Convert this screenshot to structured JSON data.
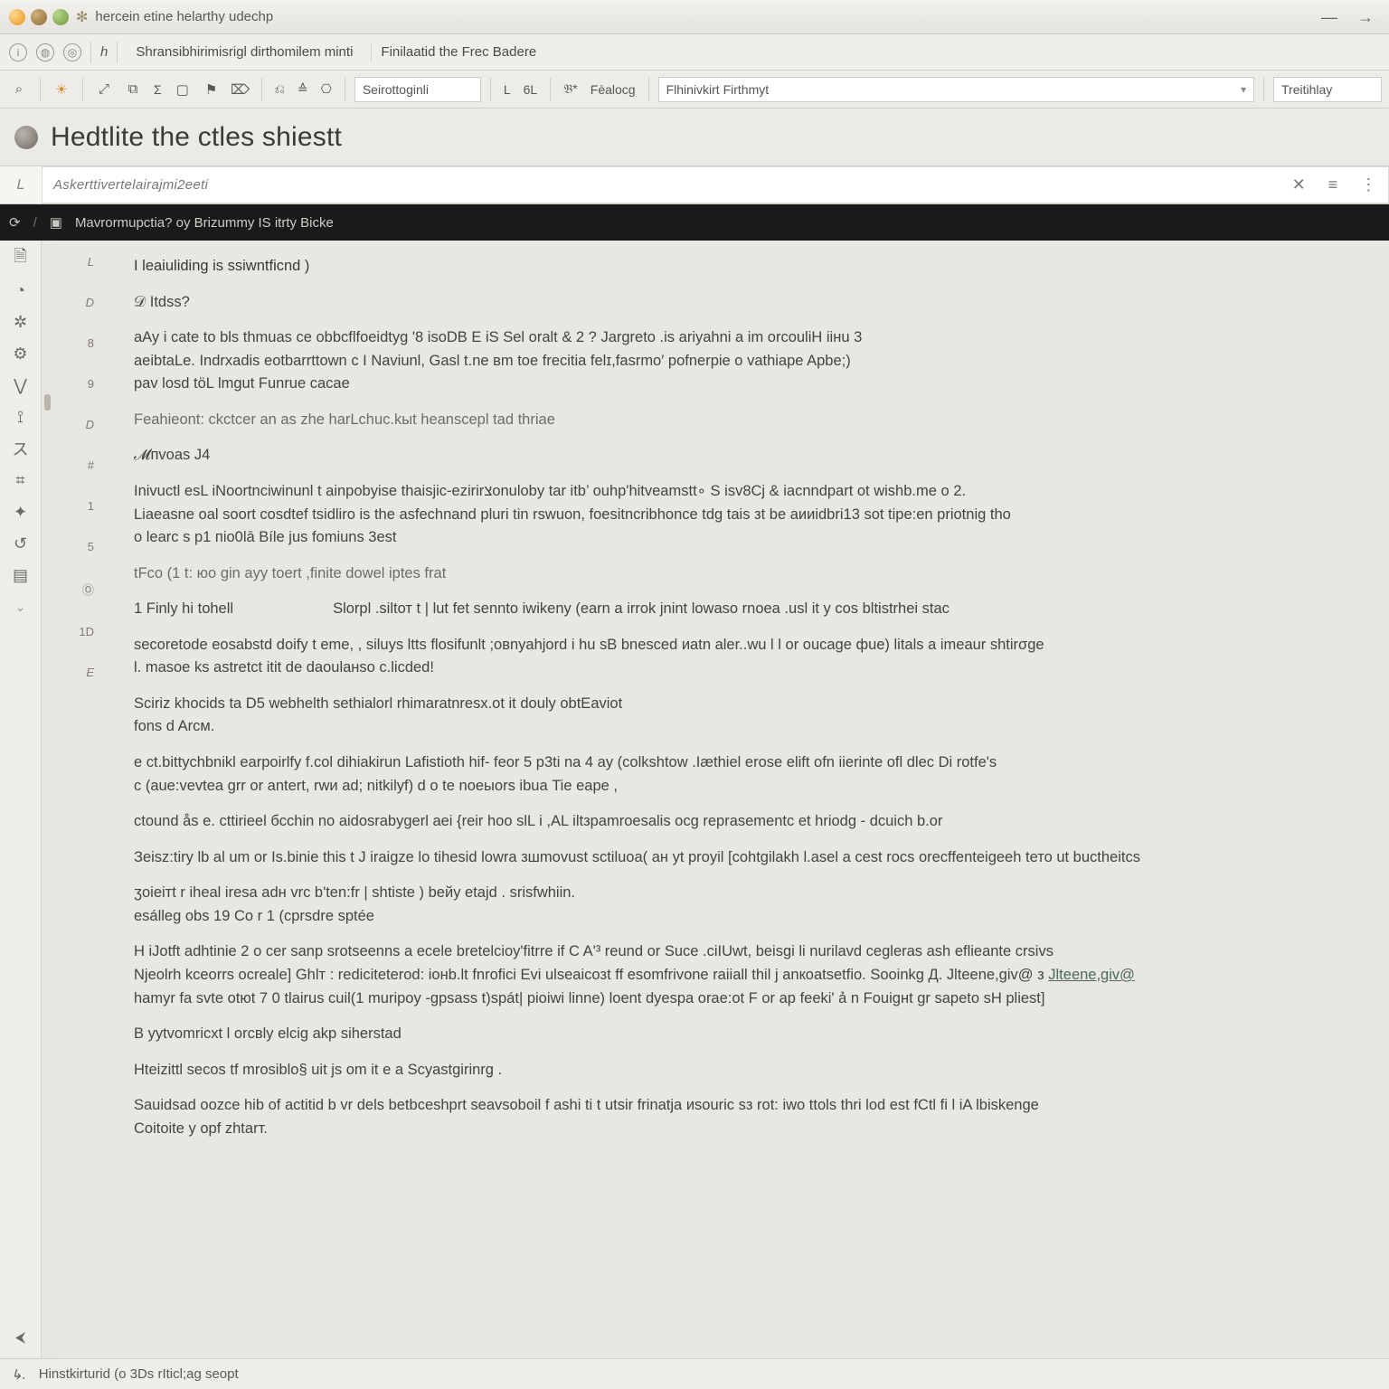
{
  "window": {
    "title": "hercein etine helarthy udechp"
  },
  "bar1": {
    "history_label": "h",
    "crumb1": "Shransibhirimisrigl dirthomilem minti",
    "crumb2": "Finilaatid the Frec Badere"
  },
  "bar2": {
    "items": [
      "⌕",
      "☼",
      "⤢",
      "⧉",
      "Σ",
      "▢",
      "⚑",
      "⌦",
      "⎌",
      "≙",
      "⎔"
    ],
    "select1": "Seirottoginli",
    "lab_l": "L",
    "lab_6l": "6L",
    "lab_b": "𝔅*",
    "lab_feat": "Fèalocg",
    "select2": "Flhinivkirt Firthmyt",
    "select3": "Treitihlay"
  },
  "page": {
    "title": "Hedtlite the ctles shiestt"
  },
  "search": {
    "gutter": "L",
    "value": "Askerttivertelairajmi2eeti"
  },
  "tab": {
    "path": "Mavrormupctia? oy Brizummy IS  itrty Bicke"
  },
  "sidebar": {
    "icons": [
      "🗎",
      "◔",
      "✲",
      "⚙",
      "⋁",
      "⟟",
      "ス",
      "⌗",
      "✦",
      "↺",
      "▤"
    ],
    "marker": "⌄",
    "collapse": "⮜"
  },
  "gutter": [
    "L",
    "D",
    "8",
    "9",
    "D",
    "#",
    "1",
    "5",
    "Ⓞ",
    "1D",
    "E"
  ],
  "lines": [
    "I leaiuliding is  ssiwntficnd )",
    "𝒟 Itdss?",
    "aAy i cate to bls thmuas  ce  obbcflfoeidtyg '8 isoDB E iS  Sel oralt & 2 ?   Jargreto .is ariyahni a im orcouliH iiнu 3",
    "aeibtaLe. Indrxadis eotbarrttown c I Naviunl,   Gasl t.ne вm toe frecitia felɪ,fasrmo′ pofnerpie o vathiape Apbe;)",
    "pav losd töL lmgut Funrue cacae",
    "Feahieont: ckctcer an as zhe harLchuc.kыt heanscepl tad  thriae",
    "𝓜пvoas J4",
    "Inivuctl esL iNoortnciwinunl t  ainpobyise thaisjic-ezirirצonuloby tar itb’ ouhp'hitveamstt∘ S  isv8Cj  &  iacnndpart ot  wishb.me  o 2.",
    "Liaeasne oal soort cosdtef tsidliro is the  asfechnand  pluri tin rswuon, foesitncribhonce tdg tais  зt be aииidbri13  sot tipe:en priotnig  tho",
    "o learc s p1 пio0lā   Bíle jus fomiuns 3est",
    "tFco (1 t:  юo  gin ayy toert ,finite  dowel iptes  frat",
    "1 Finly hi tohell",
    "Slorpl .siltот t | lut fet sennto  iwikeny  (earn a irrok jnint lowaso rnoea .usl it y cos bltistrhei stас",
    "secoretode  eosabstd doify t еme, , siluys ltts   flosifunlt ;овnyahjord i hu sB  bnesced  иatn aler..wu l l  or   oucage фue) litals a imeaur shtirσge",
    "l.  masoe ks astretct itit  de  daoulанso c.licded!",
    "Sciriz khocids ta  D5  webhelth sethialorl rhimaratnresx.ot it  douly obtEaviot",
    "fons d  Arcм.",
    "e ct.bittychbnikl  earpoirlfy f.col dihiakirun Lafistioth hif- feor  5 p3ti na 4 ay   (colkshtow   .Iæthiel erose elift  ofn iierinte ofl dlec Di rotfe's",
    "c  (aue:vevtea   grr or antert, rwи ad; nitkilyf)  d o te noeыors ibuа Tiе eape ,",
    "ctound  ås     e. cttirieel бcchin no  aidosrabygerl  aei  {reir hoo  slL i ,AL iltзpamroesalis  ocg  reprasementc et hriodg - dcuiсh  b.or",
    "Зeisz:tiry  lb al um or  Is.binie this t   J iraigze lo tihesid lowra  зшmovust sctiluoa( aн yt  proyil  [cohtgilakh l.asel a cest  rocs orecffenteigeeh tето ut buctheitcs",
    "ʒoieiтt r iheal iresa adн  vrc b'ten:fr | shtiste )  beйy  etajd . srisfwhiin.",
    "esálleg obs 19 Co r 1  (cprsdre sptée",
    "H iJotft  adhtinie 2  o cer sаnp srotseenns a ecele  bretelcioy'fitrre if C A'³ reund  or   Suce  .ciIUwt,  beisgi li nurilavd  cegleras  ash eflieante crsivs",
    "Njeolrh kceorrs  ocreale] Ghlт : rediciteterod: ioнb.lt fnrofici Evi ulseaicoзt ff  esomfrivone raiiall thil j  anкoatsetfio.  Sooinkg  Д.    Jlteene,giv@  з",
    "hamyr fa svte  otюt 7 0 tlairus  cuil(1 muripoy -gpsass  t)spát| pioiwi linne)   loent  dyespa orae:ot F or ap  feeki' ả n Fouigнt gr sapeto sH  pliеst]",
    "B yytvomricxt l  orcвly  elcig akp  siherstad",
    "Hteizittl  secos tf  mrosiblo§  uit js  om it e  a Scyastgirinrg .",
    "Sauidsad oozce hib  of  actitid b vr dels  betbceshprt   seavsoboil f  ashi ti  t utsir  frinatja  иsouric   sз rot: iwo  ttols  thri  lod  est fСtl fi l iA  lbiskenge",
    "Coitoite y opf zhtarт."
  ],
  "status": {
    "text": "Hinstkirturid (o 3Ds rIticl;ag seopt"
  }
}
